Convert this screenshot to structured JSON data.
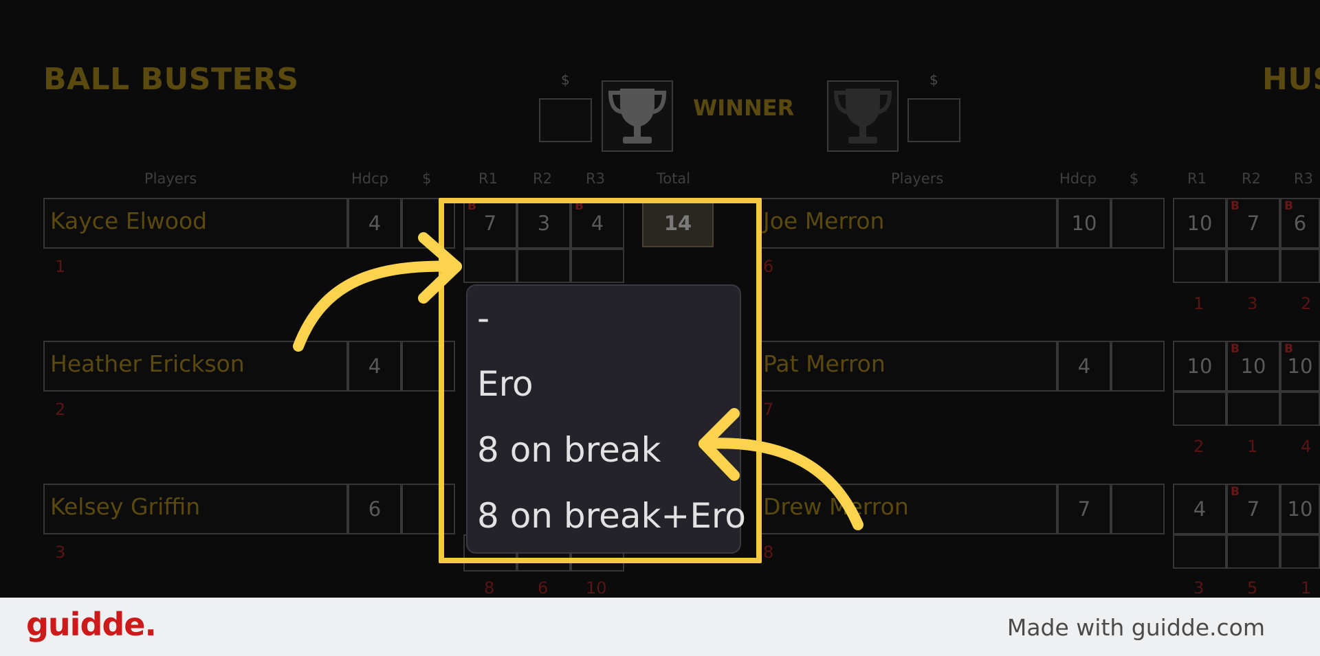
{
  "scoreboard": {
    "left_team": "BALL BUSTERS",
    "right_team": "HUS",
    "dollar_label": "$",
    "winner_label": "WINNER",
    "columns_left": [
      "Players",
      "Hdcp",
      "$",
      "R1",
      "R2",
      "R3",
      "Total"
    ],
    "columns_right": [
      "Players",
      "Hdcp",
      "$",
      "R1",
      "R2",
      "R3"
    ],
    "left_rows": [
      {
        "name": "Kayce Elwood",
        "hdcp": "4",
        "seq": "1",
        "r1": "7",
        "r2": "3",
        "r3": "4",
        "total": "14",
        "r1_b": "B",
        "r3_b": "B"
      },
      {
        "name": "Heather Erickson",
        "hdcp": "4",
        "seq": "2"
      },
      {
        "name": "Kelsey Griffin",
        "hdcp": "6",
        "seq": "3",
        "bottom": [
          "8",
          "6",
          "10"
        ]
      }
    ],
    "right_rows": [
      {
        "name": "Joe Merron",
        "hdcp": "10",
        "seq": "6",
        "r1": "10",
        "r2": "7",
        "r3": "6",
        "r2_b": "B",
        "r3_b": "B",
        "sub": [
          "1",
          "3",
          "2"
        ]
      },
      {
        "name": "Pat Merron",
        "hdcp": "4",
        "seq": "7",
        "r1": "10",
        "r2": "10",
        "r3": "10",
        "r2_b": "B",
        "r3_b": "B",
        "sub": [
          "2",
          "1",
          "4"
        ]
      },
      {
        "name": "Drew Merron",
        "hdcp": "7",
        "seq": "8",
        "r1": "4",
        "r2": "7",
        "r3": "10",
        "r2_b": "B",
        "sub": [
          "3",
          "5",
          "1"
        ]
      }
    ]
  },
  "dropdown": {
    "options": [
      "-",
      "Ero",
      "8 on break",
      "8 on break+Ero"
    ]
  },
  "footer": {
    "brand": "guidde.",
    "made_with": "Made with guidde.com"
  },
  "colors": {
    "highlight": "#f5c842",
    "arrow": "#fcd34d",
    "brand": "#cc1a1a"
  }
}
